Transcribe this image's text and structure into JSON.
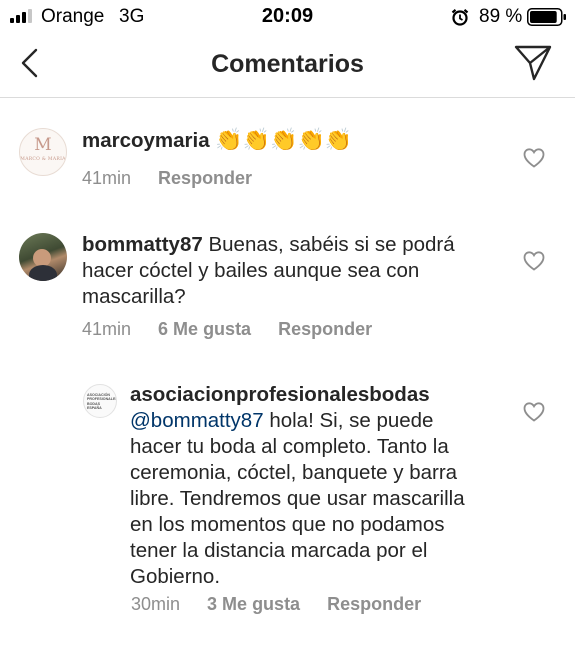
{
  "status_bar": {
    "carrier": "Orange",
    "network": "3G",
    "time": "20:09",
    "battery_percent": "89 %",
    "signal_bars": 3,
    "battery_level": 0.89,
    "icons": [
      "signal-icon",
      "alarm-icon",
      "battery-icon"
    ]
  },
  "header": {
    "title": "Comentarios",
    "icons": [
      "chevron-left-icon",
      "send-icon"
    ]
  },
  "comments": [
    {
      "username": "marcoymaria",
      "text": "👏👏👏👏👏",
      "time": "41min",
      "likes": "",
      "reply_label": "Responder",
      "avatar_text": "M",
      "avatar_caption": "MARCO & MARIA"
    },
    {
      "username": "bommatty87",
      "text": "Buenas, sabéis si se podrá hacer cóctel y bailes aunque sea con mascarilla?",
      "time": "41min",
      "likes": "6 Me gusta",
      "reply_label": "Responder"
    },
    {
      "username": "asociacionprofesionalesbodas",
      "mention": "@bommatty87",
      "text": "hola! Si, se puede hacer tu boda al completo. Tanto la ceremonia, cóctel, banquete y barra libre. Tendremos que usar mascarilla en los momentos que no podamos tener la distancia marcada por el Gobierno.",
      "time": "30min",
      "likes": "3 Me gusta",
      "reply_label": "Responder",
      "avatar_caption": "ASOCIACIÓN PROFESIONALES BODAS ESPAÑA"
    }
  ],
  "colors": {
    "text": "#262626",
    "meta": "#8e8e8e",
    "mention": "#003569",
    "divider": "#dbdbdb"
  }
}
